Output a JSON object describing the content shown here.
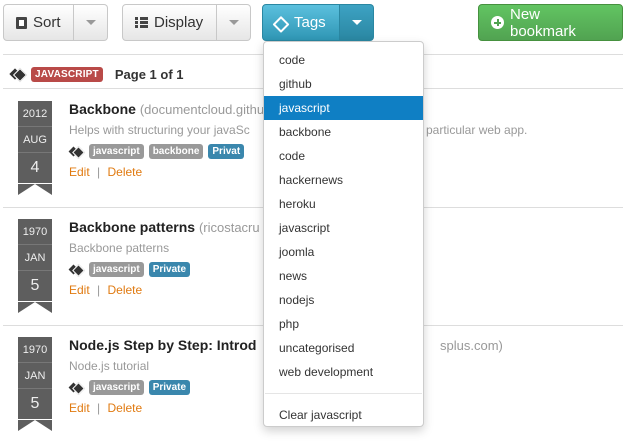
{
  "toolbar": {
    "sort_label": "Sort",
    "display_label": "Display",
    "tags_label": "Tags",
    "new_bookmark_label": "New bookmark"
  },
  "header": {
    "tag_badge": "JAVASCRIPT",
    "page_text": "Page 1 of 1"
  },
  "bookmarks": [
    {
      "year": "2012",
      "month": "AUG",
      "day": "4",
      "title": "Backbone",
      "domain": "(documentcloud.githu",
      "description_left": "Helps with structuring your javaSc",
      "description_right": "particular web app.",
      "tags": [
        "javascript",
        "backbone",
        "Privat"
      ],
      "edit": "Edit",
      "delete": "Delete",
      "sep": "|"
    },
    {
      "year": "1970",
      "month": "JAN",
      "day": "5",
      "title": "Backbone patterns",
      "domain": "(ricostacru",
      "description_left": "Backbone patterns",
      "description_right": "",
      "tags": [
        "javascript",
        "Private"
      ],
      "edit": "Edit",
      "delete": "Delete",
      "sep": "|"
    },
    {
      "year": "1970",
      "month": "JAN",
      "day": "5",
      "title": "Node.js Step by Step: Introd",
      "domain": "splus.com)",
      "description_left": "Node.js tutorial",
      "description_right": "",
      "tags": [
        "javascript",
        "Private"
      ],
      "edit": "Edit",
      "delete": "Delete",
      "sep": "|"
    }
  ],
  "dropdown": {
    "items": [
      "code",
      "github",
      "javascript",
      "backbone",
      "code",
      "hackernews",
      "heroku",
      "javascript",
      "joomla",
      "news",
      "nodejs",
      "php",
      "uncategorised",
      "web development"
    ],
    "active_index": 2,
    "clear_label": "Clear javascript"
  },
  "colors": {
    "info": "#2f96b4",
    "success": "#51a351",
    "danger_label": "#b94a48",
    "active_item": "#0f7fc4",
    "link": "#e07a10"
  }
}
